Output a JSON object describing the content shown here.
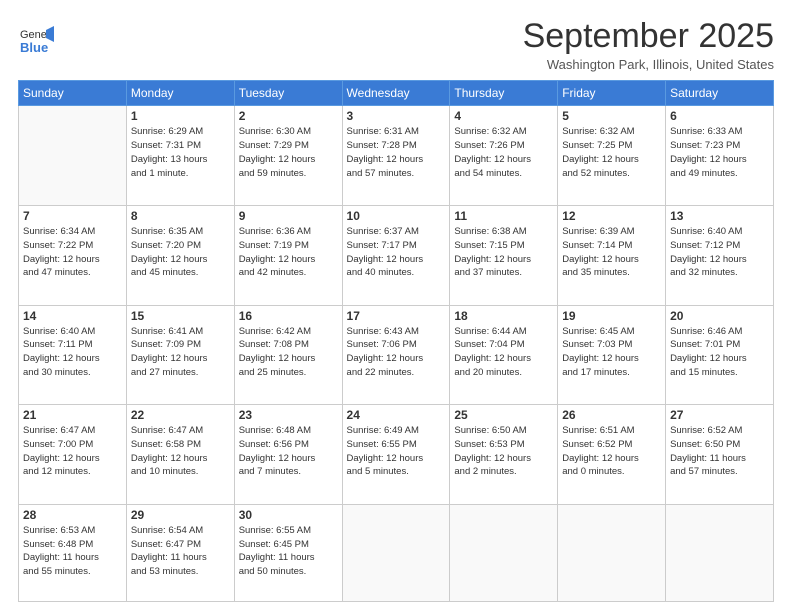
{
  "header": {
    "logo": {
      "line1": "General",
      "line2": "Blue"
    },
    "title": "September 2025",
    "location": "Washington Park, Illinois, United States"
  },
  "days_of_week": [
    "Sunday",
    "Monday",
    "Tuesday",
    "Wednesday",
    "Thursday",
    "Friday",
    "Saturday"
  ],
  "weeks": [
    [
      {
        "day": "",
        "info": ""
      },
      {
        "day": "1",
        "info": "Sunrise: 6:29 AM\nSunset: 7:31 PM\nDaylight: 13 hours\nand 1 minute."
      },
      {
        "day": "2",
        "info": "Sunrise: 6:30 AM\nSunset: 7:29 PM\nDaylight: 12 hours\nand 59 minutes."
      },
      {
        "day": "3",
        "info": "Sunrise: 6:31 AM\nSunset: 7:28 PM\nDaylight: 12 hours\nand 57 minutes."
      },
      {
        "day": "4",
        "info": "Sunrise: 6:32 AM\nSunset: 7:26 PM\nDaylight: 12 hours\nand 54 minutes."
      },
      {
        "day": "5",
        "info": "Sunrise: 6:32 AM\nSunset: 7:25 PM\nDaylight: 12 hours\nand 52 minutes."
      },
      {
        "day": "6",
        "info": "Sunrise: 6:33 AM\nSunset: 7:23 PM\nDaylight: 12 hours\nand 49 minutes."
      }
    ],
    [
      {
        "day": "7",
        "info": "Sunrise: 6:34 AM\nSunset: 7:22 PM\nDaylight: 12 hours\nand 47 minutes."
      },
      {
        "day": "8",
        "info": "Sunrise: 6:35 AM\nSunset: 7:20 PM\nDaylight: 12 hours\nand 45 minutes."
      },
      {
        "day": "9",
        "info": "Sunrise: 6:36 AM\nSunset: 7:19 PM\nDaylight: 12 hours\nand 42 minutes."
      },
      {
        "day": "10",
        "info": "Sunrise: 6:37 AM\nSunset: 7:17 PM\nDaylight: 12 hours\nand 40 minutes."
      },
      {
        "day": "11",
        "info": "Sunrise: 6:38 AM\nSunset: 7:15 PM\nDaylight: 12 hours\nand 37 minutes."
      },
      {
        "day": "12",
        "info": "Sunrise: 6:39 AM\nSunset: 7:14 PM\nDaylight: 12 hours\nand 35 minutes."
      },
      {
        "day": "13",
        "info": "Sunrise: 6:40 AM\nSunset: 7:12 PM\nDaylight: 12 hours\nand 32 minutes."
      }
    ],
    [
      {
        "day": "14",
        "info": "Sunrise: 6:40 AM\nSunset: 7:11 PM\nDaylight: 12 hours\nand 30 minutes."
      },
      {
        "day": "15",
        "info": "Sunrise: 6:41 AM\nSunset: 7:09 PM\nDaylight: 12 hours\nand 27 minutes."
      },
      {
        "day": "16",
        "info": "Sunrise: 6:42 AM\nSunset: 7:08 PM\nDaylight: 12 hours\nand 25 minutes."
      },
      {
        "day": "17",
        "info": "Sunrise: 6:43 AM\nSunset: 7:06 PM\nDaylight: 12 hours\nand 22 minutes."
      },
      {
        "day": "18",
        "info": "Sunrise: 6:44 AM\nSunset: 7:04 PM\nDaylight: 12 hours\nand 20 minutes."
      },
      {
        "day": "19",
        "info": "Sunrise: 6:45 AM\nSunset: 7:03 PM\nDaylight: 12 hours\nand 17 minutes."
      },
      {
        "day": "20",
        "info": "Sunrise: 6:46 AM\nSunset: 7:01 PM\nDaylight: 12 hours\nand 15 minutes."
      }
    ],
    [
      {
        "day": "21",
        "info": "Sunrise: 6:47 AM\nSunset: 7:00 PM\nDaylight: 12 hours\nand 12 minutes."
      },
      {
        "day": "22",
        "info": "Sunrise: 6:47 AM\nSunset: 6:58 PM\nDaylight: 12 hours\nand 10 minutes."
      },
      {
        "day": "23",
        "info": "Sunrise: 6:48 AM\nSunset: 6:56 PM\nDaylight: 12 hours\nand 7 minutes."
      },
      {
        "day": "24",
        "info": "Sunrise: 6:49 AM\nSunset: 6:55 PM\nDaylight: 12 hours\nand 5 minutes."
      },
      {
        "day": "25",
        "info": "Sunrise: 6:50 AM\nSunset: 6:53 PM\nDaylight: 12 hours\nand 2 minutes."
      },
      {
        "day": "26",
        "info": "Sunrise: 6:51 AM\nSunset: 6:52 PM\nDaylight: 12 hours\nand 0 minutes."
      },
      {
        "day": "27",
        "info": "Sunrise: 6:52 AM\nSunset: 6:50 PM\nDaylight: 11 hours\nand 57 minutes."
      }
    ],
    [
      {
        "day": "28",
        "info": "Sunrise: 6:53 AM\nSunset: 6:48 PM\nDaylight: 11 hours\nand 55 minutes."
      },
      {
        "day": "29",
        "info": "Sunrise: 6:54 AM\nSunset: 6:47 PM\nDaylight: 11 hours\nand 53 minutes."
      },
      {
        "day": "30",
        "info": "Sunrise: 6:55 AM\nSunset: 6:45 PM\nDaylight: 11 hours\nand 50 minutes."
      },
      {
        "day": "",
        "info": ""
      },
      {
        "day": "",
        "info": ""
      },
      {
        "day": "",
        "info": ""
      },
      {
        "day": "",
        "info": ""
      }
    ]
  ]
}
